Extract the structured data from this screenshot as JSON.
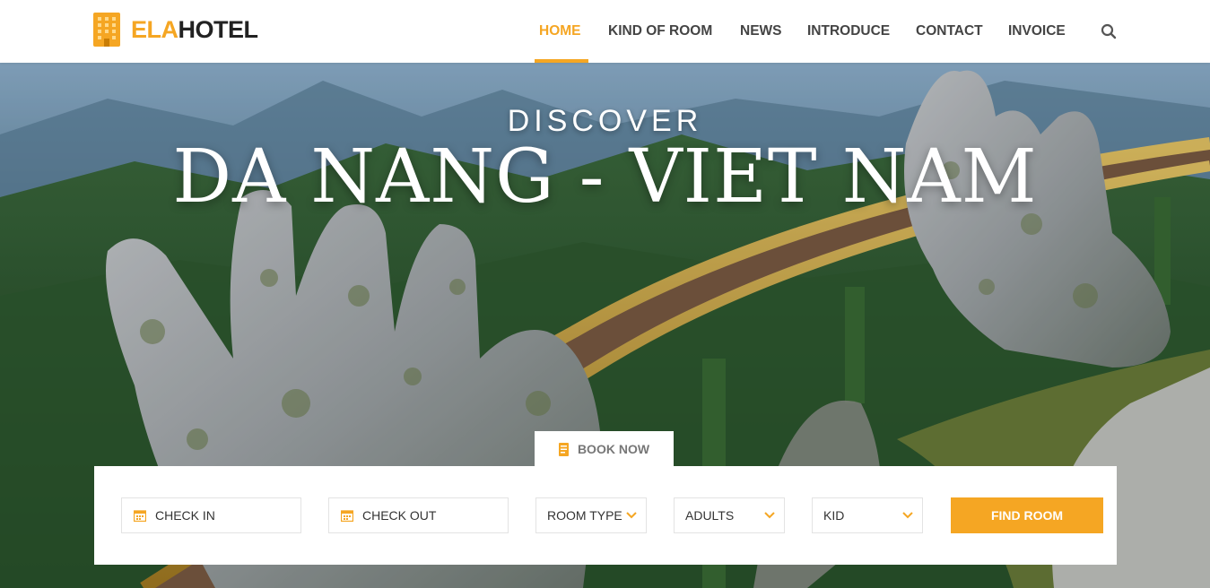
{
  "brand": {
    "name_accent": "ELA",
    "name_rest": "HOTEL",
    "accent_color": "#f5a623"
  },
  "nav": {
    "items": [
      {
        "label": "HOME",
        "active": true
      },
      {
        "label": "KIND OF ROOM",
        "active": false
      },
      {
        "label": "NEWS",
        "active": false
      },
      {
        "label": "INTRODUCE",
        "active": false
      },
      {
        "label": "CONTACT",
        "active": false
      },
      {
        "label": "INVOICE",
        "active": false
      }
    ],
    "search_icon": "search-icon"
  },
  "hero": {
    "kicker": "DISCOVER",
    "title": "DA NANG - VIET NAM"
  },
  "booking": {
    "tab_label": "BOOK NOW",
    "fields": {
      "check_in": "CHECK IN",
      "check_out": "CHECK OUT",
      "room_type": "ROOM TYPE",
      "adults": "ADULTS",
      "kid": "KID"
    },
    "button_label": "FIND ROOM"
  }
}
